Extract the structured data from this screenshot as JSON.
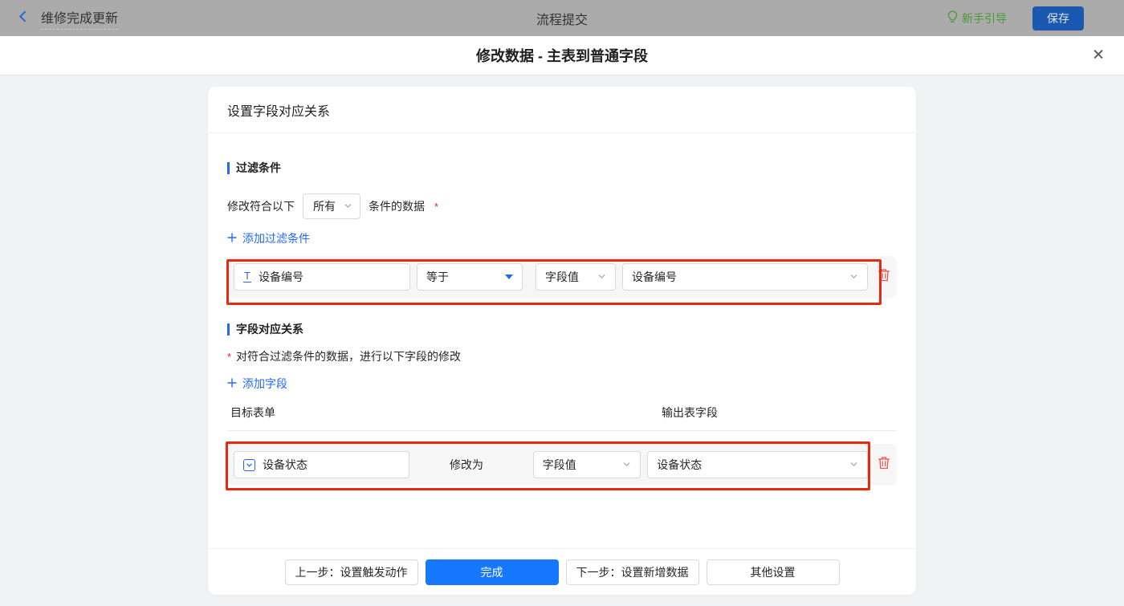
{
  "topbar": {
    "back_label": "维修完成更新",
    "center_title": "流程提交",
    "guide_label": "新手引导",
    "save_label": "保存"
  },
  "modal": {
    "title": "修改数据 - 主表到普通字段"
  },
  "icons": {
    "close_glyph": "✕",
    "text_field_glyph": "T"
  },
  "panel": {
    "header": "设置字段对应关系",
    "filter_section": {
      "title": "过滤条件",
      "condition_prefix": "修改符合以下",
      "condition_select_value": "所有",
      "condition_suffix": "条件的数据",
      "required_mark": "*",
      "add_link_label": "添加过滤条件",
      "row": {
        "field_value": "设备编号",
        "operator_value": "等于",
        "type_value": "字段值",
        "source_value": "设备编号"
      }
    },
    "mapping_section": {
      "title": "字段对应关系",
      "required_mark": "*",
      "description": "对符合过滤条件的数据，进行以下字段的修改",
      "add_link_label": "添加字段",
      "col_target": "目标表单",
      "col_output": "输出表字段",
      "row": {
        "field_value": "设备状态",
        "middle_label": "修改为",
        "type_value": "字段值",
        "source_value": "设备状态"
      }
    },
    "footer": {
      "prev_label": "上一步：设置触发动作",
      "done_label": "完成",
      "next_label": "下一步：设置新增数据",
      "other_label": "其他设置"
    }
  },
  "colors": {
    "primary_blue": "#1677ff",
    "link_blue": "#2468f2",
    "annotation_red": "#e8290f",
    "trash_red": "#f0544a",
    "guide_green": "#4c9a34",
    "topbar_gray": "#ababab",
    "row_bg": "#f6f6f7"
  }
}
